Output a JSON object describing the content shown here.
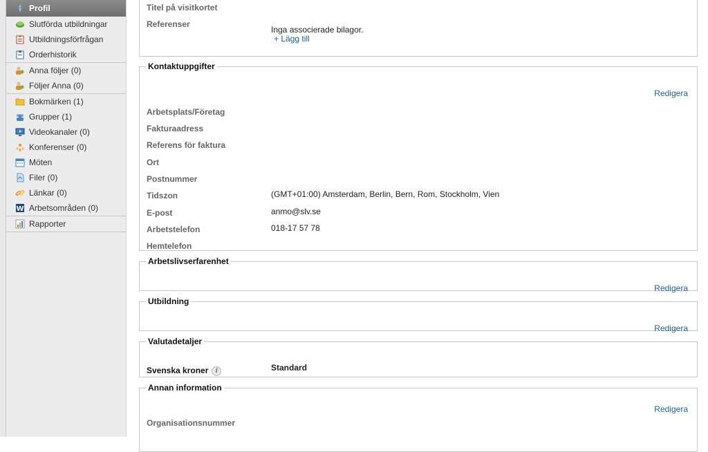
{
  "sidebar": {
    "groups": [
      [
        {
          "label": "Profil",
          "icon": "profile-icon",
          "active": true
        },
        {
          "label": "Slutförda utbildningar",
          "icon": "completed-courses-icon"
        },
        {
          "label": "Utbildningsförfrågan",
          "icon": "clipboard-icon"
        },
        {
          "label": "Orderhistorik",
          "icon": "order-history-icon"
        }
      ],
      [
        {
          "label": "Anna följer (0)",
          "icon": "followers-icon"
        },
        {
          "label": "Följer Anna (0)",
          "icon": "following-icon"
        }
      ],
      [
        {
          "label": "Bokmärken (1)",
          "icon": "folder-icon"
        },
        {
          "label": "Grupper (1)",
          "icon": "groups-icon"
        },
        {
          "label": "Videokanaler (0)",
          "icon": "video-channel-icon"
        },
        {
          "label": "Konferenser (0)",
          "icon": "conference-icon"
        },
        {
          "label": "Möten",
          "icon": "calendar-icon"
        },
        {
          "label": "Filer (0)",
          "icon": "file-icon"
        },
        {
          "label": "Länkar (0)",
          "icon": "link-icon"
        },
        {
          "label": "Arbetsområden (0)",
          "icon": "workspace-icon"
        }
      ],
      [
        {
          "label": "Rapporter",
          "icon": "report-icon"
        }
      ]
    ]
  },
  "card": {
    "title_label": "Titel på visitkortet",
    "references_label": "Referenser",
    "no_attachments": "Inga associerade bilagor.",
    "add_link": "+ Lägg till"
  },
  "contact": {
    "legend": "Kontaktuppgifter",
    "edit": "Redigera",
    "fields": [
      {
        "label": "Arbetsplats/Företag",
        "value": ""
      },
      {
        "label": "Fakturaadress",
        "value": ""
      },
      {
        "label": "Referens för faktura",
        "value": ""
      },
      {
        "label": "Ort",
        "value": ""
      },
      {
        "label": "Postnummer",
        "value": ""
      },
      {
        "label": "Tidszon",
        "value": "(GMT+01:00) Amsterdam, Berlin, Bern, Rom, Stockholm, Vien"
      },
      {
        "label": "E-post",
        "value": "anmo@slv.se"
      },
      {
        "label": "Arbetstelefon",
        "value": "018-17 57 78"
      },
      {
        "label": "Hemtelefon",
        "value": ""
      }
    ]
  },
  "experience": {
    "legend": "Arbetslivserfarenhet",
    "edit": "Redigera"
  },
  "education": {
    "legend": "Utbildning",
    "edit": "Redigera"
  },
  "currency": {
    "legend": "Valutadetaljer",
    "label": "Svenska kroner",
    "value": "Standard"
  },
  "other": {
    "legend": "Annan information",
    "edit": "Redigera",
    "org_label": "Organisationsnummer"
  },
  "colors": {
    "link": "#1f5f9c",
    "sidebar_bg": "#ececec",
    "active_bg": "#7a7a7a",
    "border": "#c8c8c8"
  }
}
